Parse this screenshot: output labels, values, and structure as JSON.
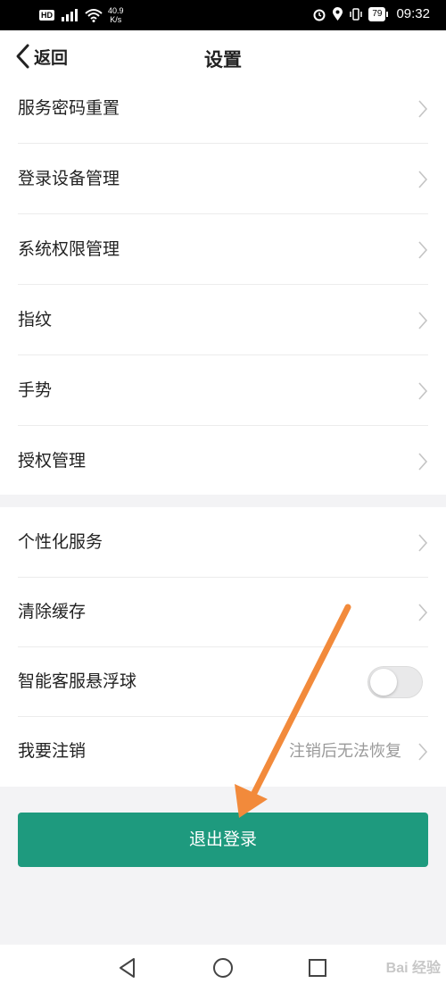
{
  "status_bar": {
    "hd": "HD",
    "net_speed_value": "40.9",
    "net_speed_unit": "K/s",
    "battery": "79",
    "time": "09:32"
  },
  "nav": {
    "back_label": "返回",
    "title": "设置"
  },
  "group1": [
    {
      "label": "服务密码重置"
    },
    {
      "label": "登录设备管理"
    },
    {
      "label": "系统权限管理"
    },
    {
      "label": "指纹"
    },
    {
      "label": "手势"
    },
    {
      "label": "授权管理"
    }
  ],
  "group2": {
    "personalized": {
      "label": "个性化服务"
    },
    "clear_cache": {
      "label": "清除缓存"
    },
    "floating_ball": {
      "label": "智能客服悬浮球",
      "enabled": false
    },
    "cancel_account": {
      "label": "我要注销",
      "value": "注销后无法恢复"
    }
  },
  "logout_button": "退出登录",
  "watermark": "Bai 经验",
  "colors": {
    "accent": "#1e9a7e",
    "annotation_arrow": "#f28a3b"
  },
  "icons": [
    "back-icon",
    "chevron-right-icon",
    "nav-back-triangle-icon",
    "nav-home-circle-icon",
    "nav-recents-square-icon"
  ]
}
